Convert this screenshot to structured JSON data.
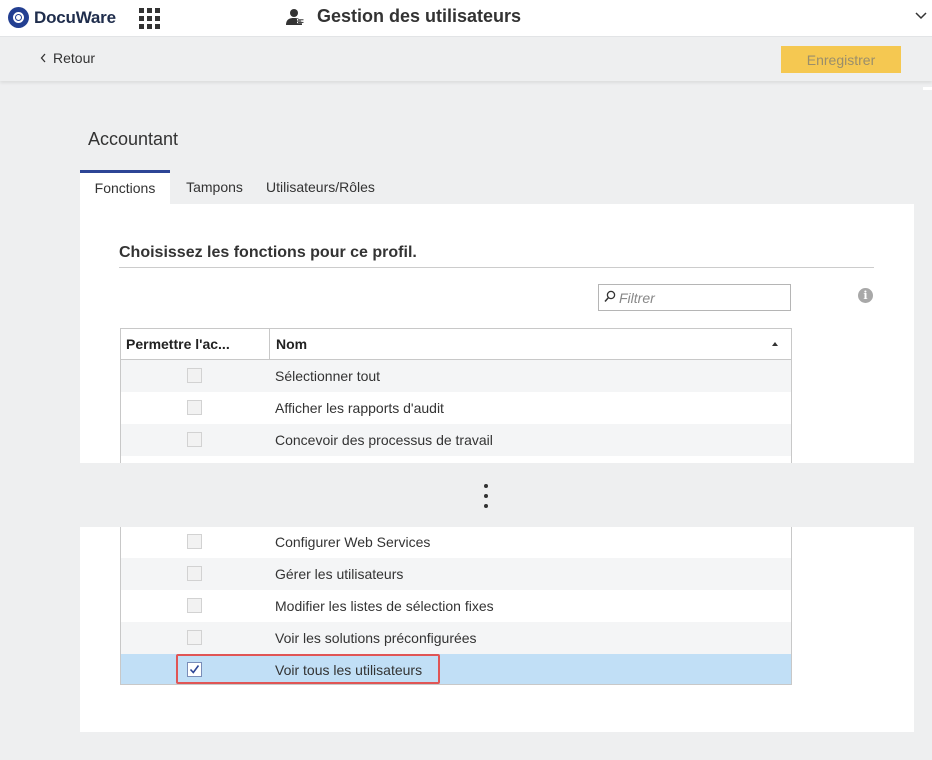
{
  "app": {
    "logo_text": "DocuWare",
    "page_title": "Gestion des utilisateurs"
  },
  "subbar": {
    "back_label": "Retour",
    "save_label": "Enregistrer"
  },
  "profile": {
    "name": "Accountant"
  },
  "tabs": [
    {
      "label": "Fonctions",
      "active": true
    },
    {
      "label": "Tampons",
      "active": false
    },
    {
      "label": "Utilisateurs/Rôles",
      "active": false
    }
  ],
  "content": {
    "heading": "Choisissez les fonctions pour ce profil.",
    "filter_placeholder": "Filtrer"
  },
  "grid": {
    "col_allow": "Permettre l'ac...",
    "col_name": "Nom",
    "rows_top": [
      {
        "label": "Sélectionner tout",
        "checked": false
      },
      {
        "label": "Afficher les rapports d'audit",
        "checked": false
      },
      {
        "label": "Concevoir des processus de travail",
        "checked": false
      }
    ],
    "rows_bottom": [
      {
        "label": "Configurer Web Services",
        "checked": false
      },
      {
        "label": "Gérer les utilisateurs",
        "checked": false
      },
      {
        "label": "Modifier les listes de sélection fixes",
        "checked": false
      },
      {
        "label": "Voir les solutions préconfigurées",
        "checked": false
      },
      {
        "label": "Voir tous les utilisateurs",
        "checked": true
      }
    ]
  },
  "colors": {
    "brand_blue": "#233f91",
    "save_yellow": "#f5c851",
    "selected_row": "#c1dff6",
    "highlight_red": "#e05555"
  }
}
